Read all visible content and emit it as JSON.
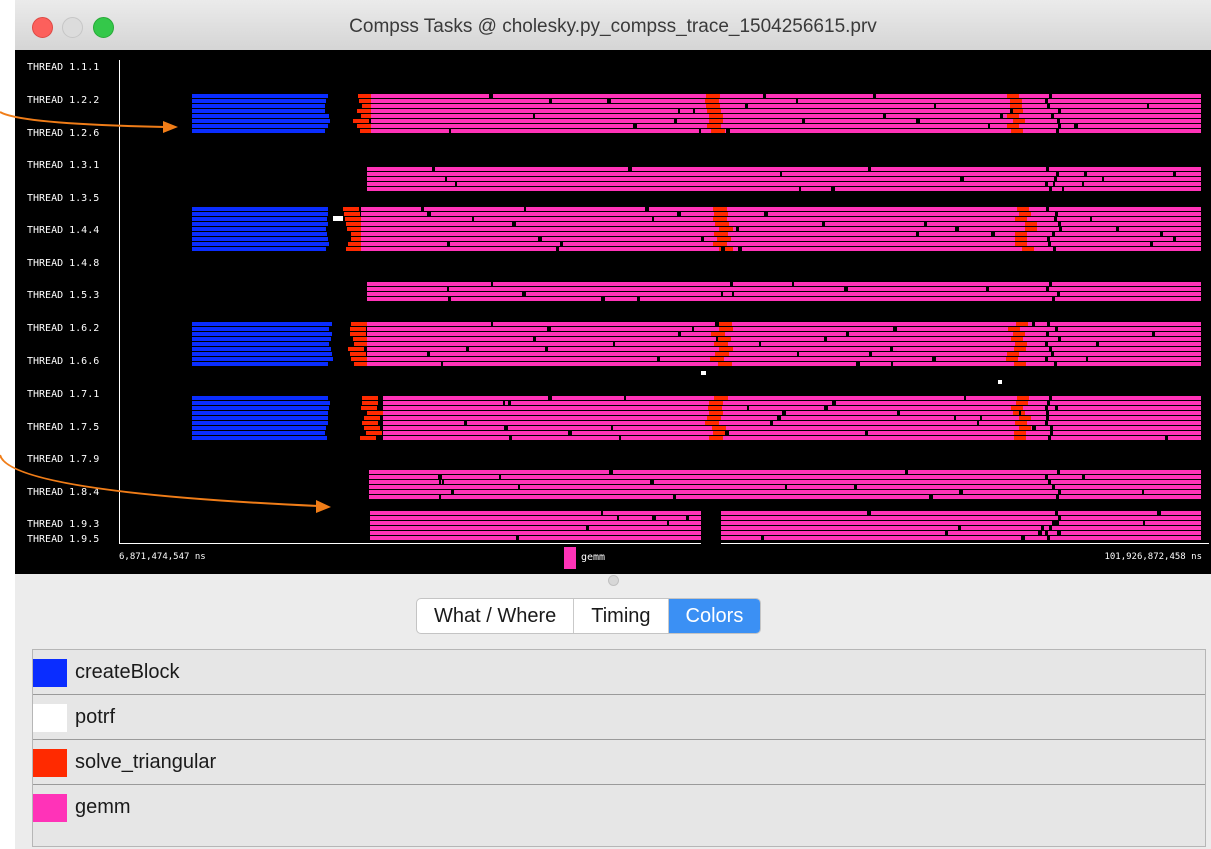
{
  "window": {
    "title": "Compss Tasks @ cholesky.py_compss_trace_1504256615.prv"
  },
  "trace": {
    "thread_labels": [
      "THREAD 1.1.1",
      "THREAD 1.2.2",
      "THREAD 1.2.6",
      "THREAD 1.3.1",
      "THREAD 1.3.5",
      "THREAD 1.4.4",
      "THREAD 1.4.8",
      "THREAD 1.5.3",
      "THREAD 1.6.2",
      "THREAD 1.6.6",
      "THREAD 1.7.1",
      "THREAD 1.7.5",
      "THREAD 1.7.9",
      "THREAD 1.8.4",
      "THREAD 1.9.3",
      "THREAD 1.9.5"
    ],
    "time_start": "6,871,474,547 ns",
    "time_end": "101,926,872,458 ns",
    "legend_label": "gemm"
  },
  "tabs": [
    {
      "label": "What / Where",
      "active": false
    },
    {
      "label": "Timing",
      "active": false
    },
    {
      "label": "Colors",
      "active": true
    }
  ],
  "colors": [
    {
      "name": "createBlock",
      "color": "#0a2dff"
    },
    {
      "name": "potrf",
      "color": "#ffffff"
    },
    {
      "name": "solve_triangular",
      "color": "#ff2a00"
    },
    {
      "name": "gemm",
      "color": "#ff33b8"
    }
  ],
  "annotation_color": "#f07d18"
}
